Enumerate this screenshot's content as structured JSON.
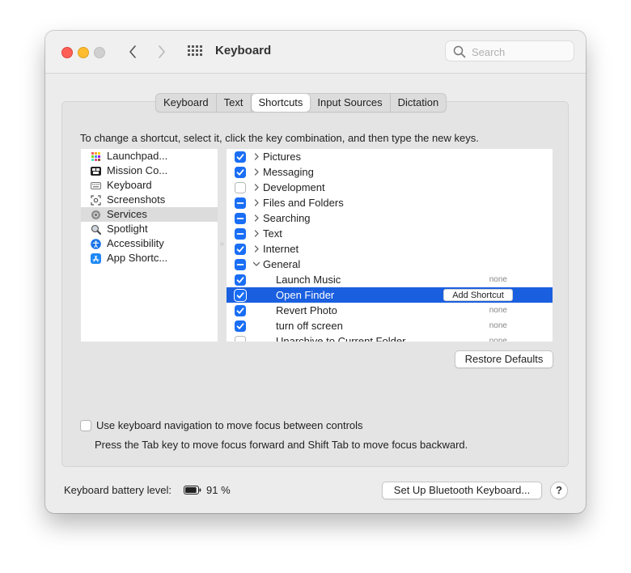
{
  "window": {
    "title": "Keyboard"
  },
  "search": {
    "placeholder": "Search"
  },
  "tabs": [
    {
      "label": "Keyboard",
      "active": false
    },
    {
      "label": "Text",
      "active": false
    },
    {
      "label": "Shortcuts",
      "active": true
    },
    {
      "label": "Input Sources",
      "active": false
    },
    {
      "label": "Dictation",
      "active": false
    }
  ],
  "instructions": "To change a shortcut, select it, click the key combination, and then type the new keys.",
  "categories": [
    {
      "label": "Launchpad...",
      "icon": "launchpad-icon",
      "selected": false
    },
    {
      "label": "Mission Co...",
      "icon": "mission-control-icon",
      "selected": false
    },
    {
      "label": "Keyboard",
      "icon": "keyboard-icon",
      "selected": false
    },
    {
      "label": "Screenshots",
      "icon": "screenshot-icon",
      "selected": false
    },
    {
      "label": "Services",
      "icon": "gear-icon",
      "selected": true
    },
    {
      "label": "Spotlight",
      "icon": "magnifier-icon",
      "selected": false
    },
    {
      "label": "Accessibility",
      "icon": "accessibility-icon",
      "selected": false
    },
    {
      "label": "App Shortc...",
      "icon": "app-store-icon",
      "selected": false
    }
  ],
  "services": [
    {
      "label": "Pictures",
      "state": "checked",
      "disclosure": "collapsed",
      "child": false
    },
    {
      "label": "Messaging",
      "state": "checked",
      "disclosure": "collapsed",
      "child": false
    },
    {
      "label": "Development",
      "state": "unchecked",
      "disclosure": "collapsed",
      "child": false
    },
    {
      "label": "Files and Folders",
      "state": "mixed",
      "disclosure": "collapsed",
      "child": false
    },
    {
      "label": "Searching",
      "state": "mixed",
      "disclosure": "collapsed",
      "child": false
    },
    {
      "label": "Text",
      "state": "mixed",
      "disclosure": "collapsed",
      "child": false
    },
    {
      "label": "Internet",
      "state": "checked",
      "disclosure": "collapsed",
      "child": false
    },
    {
      "label": "General",
      "state": "mixed",
      "disclosure": "expanded",
      "child": false
    },
    {
      "label": "Launch Music",
      "state": "checked",
      "child": true,
      "shortcut": "none"
    },
    {
      "label": "Open Finder",
      "state": "checked",
      "child": true,
      "selected": true,
      "shortcut_button": "Add Shortcut"
    },
    {
      "label": "Revert Photo",
      "state": "checked",
      "child": true,
      "shortcut": "none"
    },
    {
      "label": "turn off screen",
      "state": "checked",
      "child": true,
      "shortcut": "none"
    },
    {
      "label": "Unarchive to Current Folder",
      "state": "unchecked",
      "child": true,
      "shortcut": "none"
    }
  ],
  "buttons": {
    "restore_defaults": "Restore Defaults",
    "setup_bluetooth": "Set Up Bluetooth Keyboard...",
    "help": "?"
  },
  "keyboard_navigation": {
    "label": "Use keyboard navigation to move focus between controls",
    "hint": "Press the Tab key to move focus forward and Shift Tab to move focus backward.",
    "checked": false
  },
  "battery": {
    "label": "Keyboard battery level:",
    "percent": "91 %",
    "level": 0.91
  },
  "colors": {
    "accent": "#1a6ef5",
    "selection": "#1a5fe0",
    "close": "#fe5f57",
    "minimize": "#febc2e"
  }
}
